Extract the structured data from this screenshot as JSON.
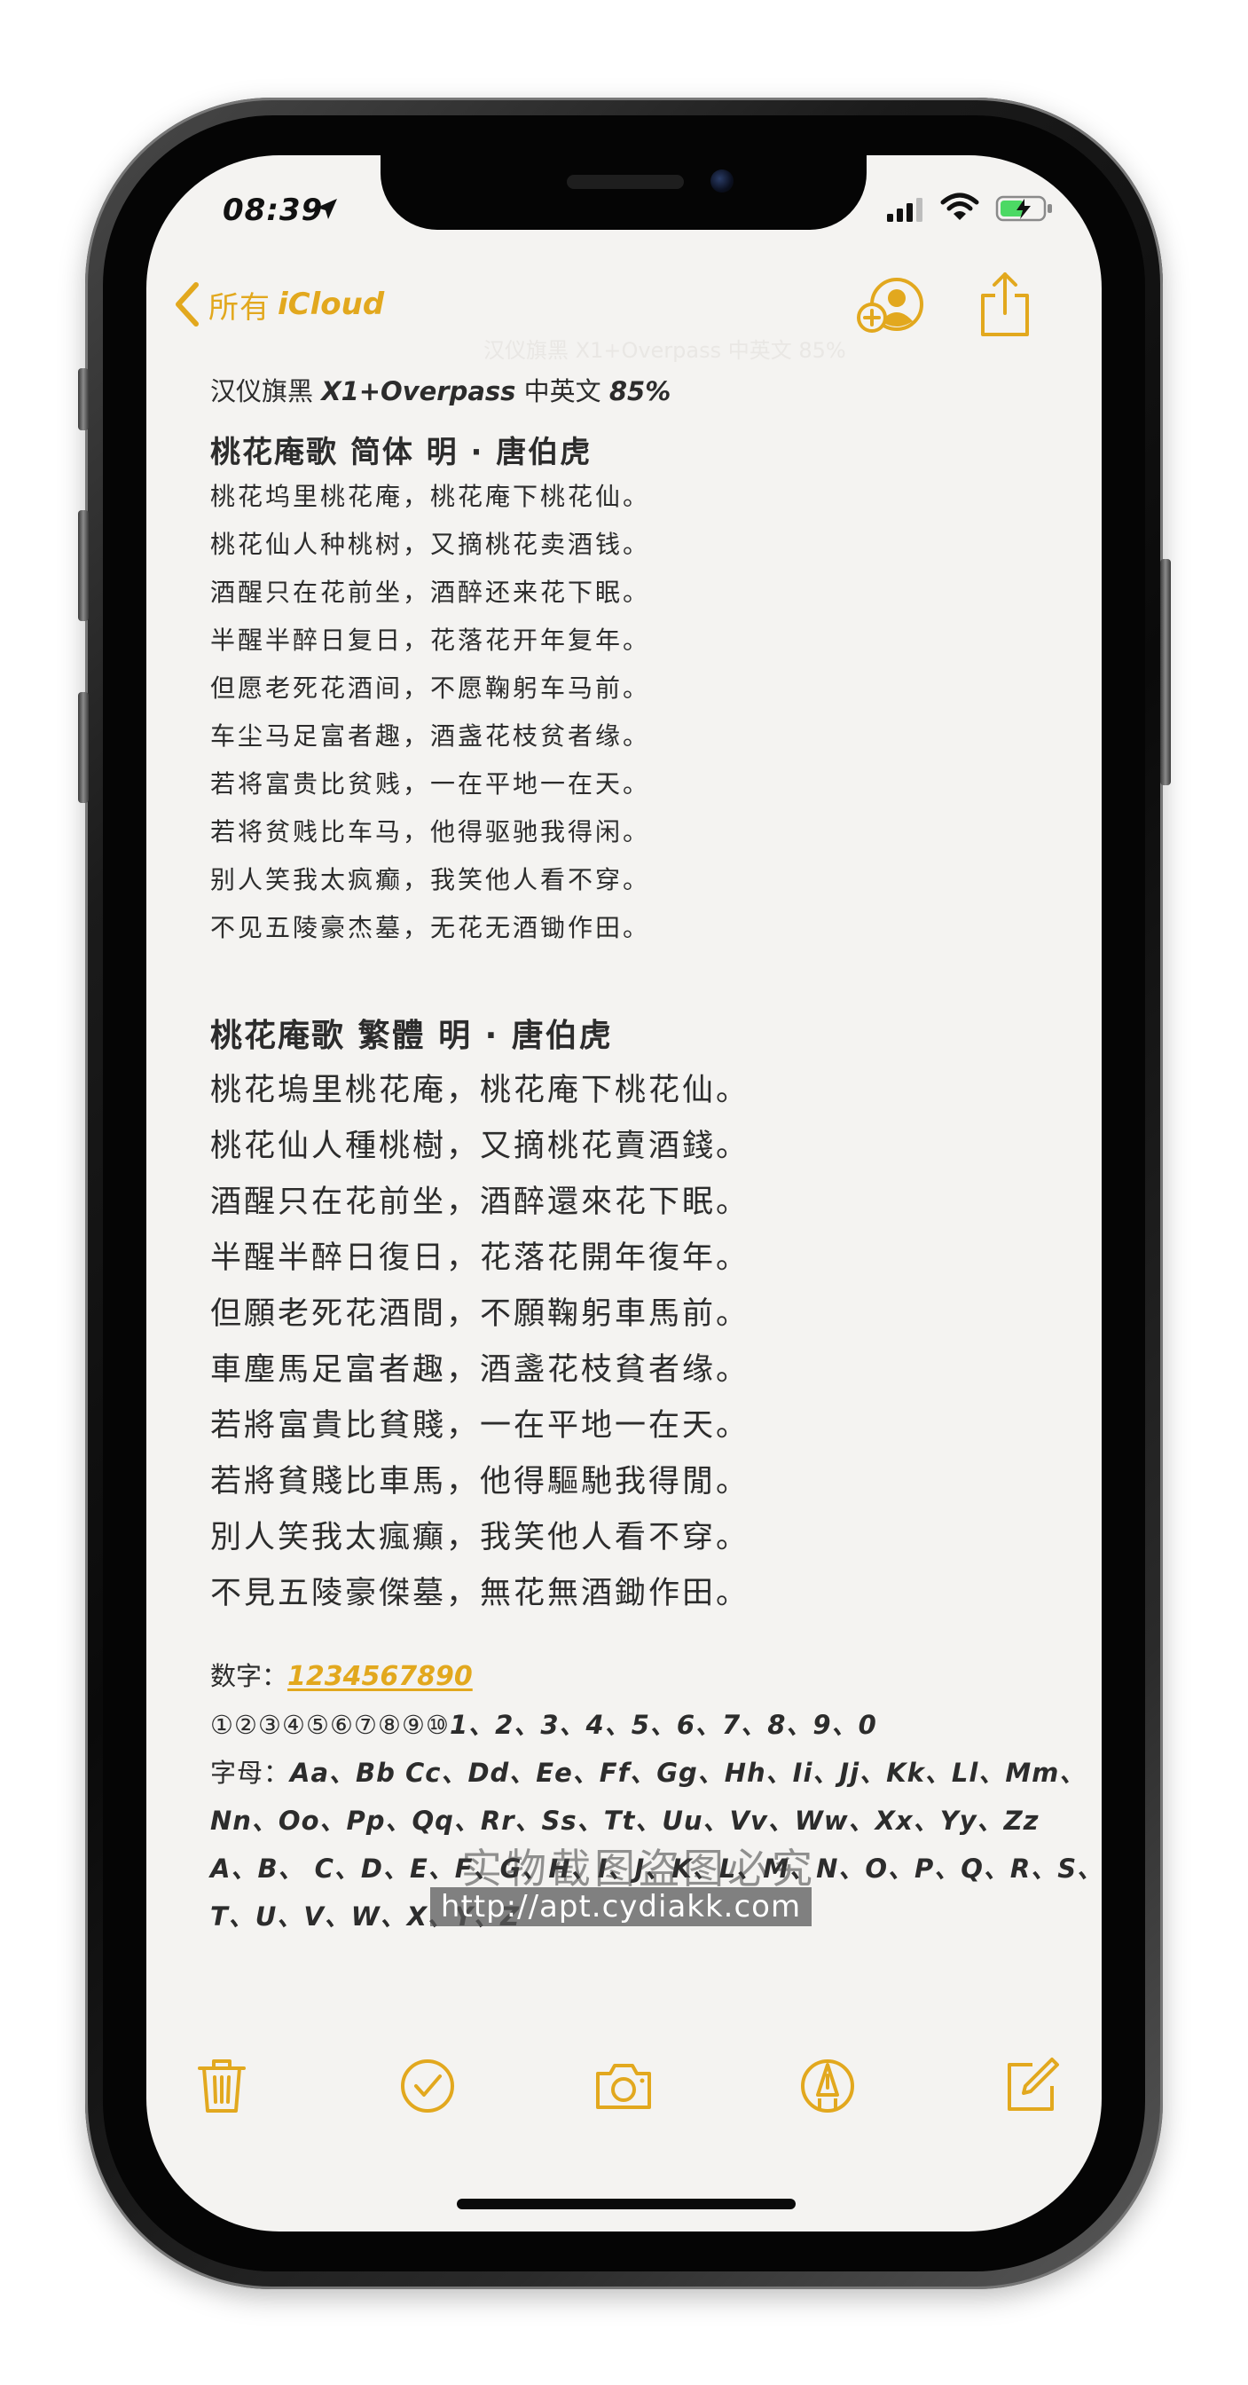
{
  "status_bar": {
    "time": "08:39"
  },
  "nav": {
    "back_label": "所有",
    "back_label_brand": "iCloud",
    "ghost_title": "汉仪旗黑 X1+Overpass 中英文 85%"
  },
  "note": {
    "font_info": {
      "prefix": "汉仪旗黑 ",
      "font_name": "X1+Overpass",
      "middle": " 中英文 ",
      "percent": "85%"
    },
    "simplified": {
      "title": "桃花庵歌   简体    明 · 唐伯虎",
      "lines": [
        "桃花坞里桃花庵，桃花庵下桃花仙。",
        "桃花仙人种桃树，又摘桃花卖酒钱。",
        "酒醒只在花前坐，酒醉还来花下眠。",
        "半醒半醉日复日，花落花开年复年。",
        "但愿老死花酒间，不愿鞠躬车马前。",
        "车尘马足富者趣，酒盏花枝贫者缘。",
        "若将富贵比贫贱，一在平地一在天。",
        "若将贫贱比车马，他得驱驰我得闲。",
        "别人笑我太疯癫，我笑他人看不穿。",
        "不见五陵豪杰墓，无花无酒锄作田。"
      ]
    },
    "traditional": {
      "title": "桃花庵歌   繁體       明 · 唐伯虎",
      "lines": [
        "桃花塢里桃花庵，桃花庵下桃花仙。",
        "桃花仙人種桃樹，又摘桃花賣酒錢。",
        "酒醒只在花前坐，酒醉還來花下眠。",
        "半醒半醉日復日，花落花開年復年。",
        "但願老死花酒間，不願鞠躬車馬前。",
        "車塵馬足富者趣，酒盞花枝貧者缘。",
        "若將富貴比貧賤，一在平地一在天。",
        "若將貧賤比車馬，他得驅馳我得閒。",
        "別人笑我太瘋癲，我笑他人看不穿。",
        "不見五陵豪傑墓，無花無酒鋤作田。"
      ]
    },
    "digits": {
      "label": "数字：",
      "value": "1234567890"
    },
    "circled_line": {
      "circled": "①②③④⑤⑥⑦⑧⑨⑩",
      "rest": "1、2、3、4、5、6、7、8、9、0"
    },
    "letters": {
      "label": "字母：",
      "line1": "Aa、Bb Cc、Dd、Ee、Ff、Gg、Hh、Ii、Jj、Kk、Ll、Mm、",
      "line2": "Nn、Oo、Pp、Qq、Rr、Ss、Tt、Uu、Vv、Ww、Xx、Yy、Zz",
      "line3": "A、B、 C、D、E、F、G、H、I、J、K、L、M、N、O、P、Q、R、S、",
      "line4": "T、U、V、W、X、Y、Z"
    }
  },
  "watermark": {
    "text": "实物截图盗图必究",
    "url": "http://apt.cydiakk.com"
  },
  "icons": {
    "location": "location-arrow-icon",
    "signal": "cellular-signal-icon",
    "wifi": "wifi-icon",
    "battery": "battery-charging-icon",
    "back": "chevron-left-icon",
    "collab": "add-person-icon",
    "share": "share-icon",
    "trash": "trash-icon",
    "checklist": "checkmark-circle-icon",
    "camera": "camera-icon",
    "markup": "pen-tip-circle-icon",
    "compose": "compose-icon"
  },
  "colors": {
    "accent": "#e2a81e",
    "text": "#2c2c2c",
    "paper": "#f4f3f1"
  }
}
